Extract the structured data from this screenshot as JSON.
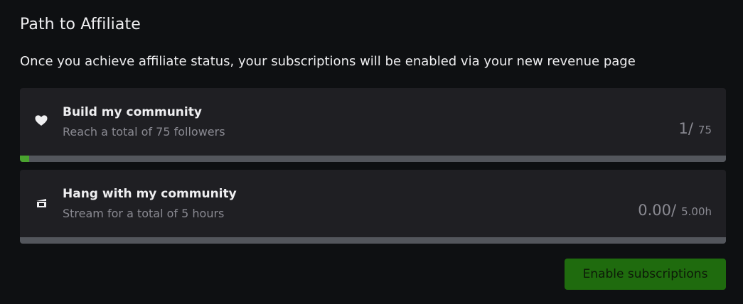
{
  "section": {
    "title": "Path to Affiliate",
    "description": "Once you achieve affiliate status, your subscriptions will be enabled via your new revenue page"
  },
  "goals": [
    {
      "icon": "heart-icon",
      "title": "Build my community",
      "description": "Reach a total of 75 followers",
      "current": "1",
      "target": "75",
      "progress_fraction": 0.0133,
      "progress_color": "#4aa32f"
    },
    {
      "icon": "clapperboard-icon",
      "title": "Hang with my community",
      "description": "Stream for a total of 5 hours",
      "current": "0.00",
      "target": "5.00h",
      "progress_fraction": 0,
      "progress_color": "#4aa32f"
    }
  ],
  "actions": {
    "enable_label": "Enable subscriptions",
    "enable_color": "#1f6b0e"
  },
  "colors": {
    "background": "#0e1012",
    "card": "#1f1f23",
    "track": "#53565c",
    "muted_text": "#8a8a92"
  }
}
